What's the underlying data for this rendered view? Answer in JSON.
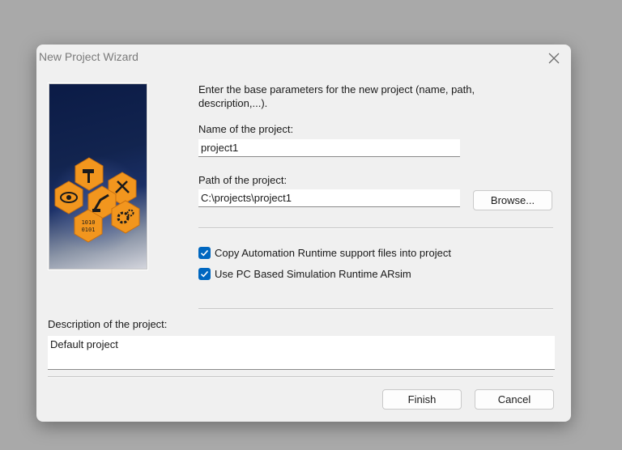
{
  "dialog": {
    "title": "New Project Wizard",
    "intro": "Enter the base parameters for the new project (name, path, description,...).",
    "name_label": "Name of the project:",
    "name_value": "project1",
    "path_label": "Path of the project:",
    "path_value": "C:\\projects\\project1",
    "browse_label": "Browse...",
    "options": [
      {
        "label": "Copy Automation Runtime support files into project",
        "checked": true
      },
      {
        "label": "Use PC Based Simulation Runtime ARsim",
        "checked": true
      }
    ],
    "description_label": "Description of the project:",
    "description_value": "Default project",
    "finish_label": "Finish",
    "cancel_label": "Cancel"
  },
  "colors": {
    "accent": "#0067c0",
    "hex_orange": "#f2961e",
    "banner_dark": "#0b1b46"
  },
  "banner_icons": [
    "hammer-icon",
    "tools-icon",
    "eye-icon",
    "robot-arm-icon",
    "binary-icon",
    "gears-icon"
  ]
}
